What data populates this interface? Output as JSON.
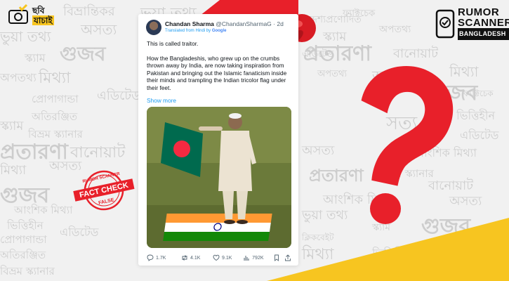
{
  "colors": {
    "brand_red": "#e8202a",
    "brand_yellow": "#f7c520",
    "link_blue": "#1d9bf0",
    "watermark_gray": "#cdcdcd"
  },
  "logo_left": {
    "line1": "ছবি",
    "line2": "যাচাই",
    "icon": "camera-check-icon"
  },
  "logo_right": {
    "line1": "RUMOR",
    "line2": "SCANNER",
    "line3": "BANGLADESH",
    "icon": "phone-check-icon"
  },
  "stamp": {
    "top": "RUMOR SCANNER",
    "middle": "FACT CHECK",
    "bottom": "FALSE"
  },
  "tweet": {
    "author_name": "Chandan Sharma",
    "handle_time": "@ChandanSharmaG · 2d",
    "translated": "Translated from Hindi by",
    "translator": "Google",
    "line1": "This is called traitor.",
    "paragraph": "How the Bangladeshis, who grew up on the crumbs thrown away by India, are now taking inspiration from Pakistan and bringing out the Islamic fanaticism inside their minds and trampling the Indian tricolor flag under their feet.",
    "show_more": "Show more",
    "replies": "1.7K",
    "reposts": "4.1K",
    "likes": "9.1K",
    "views": "792K"
  },
  "watermarks": {
    "w1": "ভুয়া তথ্য",
    "w2": "বিভ্রান্তিকর",
    "w3": "আংশিক মিথ্যা",
    "w4": "অসত্য",
    "w5": "গুজব",
    "w6": "বানোয়াট",
    "w7": "প্রতারণা",
    "w8": "অপতথ্য",
    "w9": "স্ক্যাম",
    "w10": "মিথ্যা",
    "w11": "এডিটেড",
    "w12": "প্রোপাগান্ডা",
    "w13": "অতিরঞ্জিত",
    "w14": "ভিত্তিহীন",
    "w15": "উদ্দেশ্যপ্রণোদিত",
    "w16": "ফ্যাক্টচেক",
    "w17": "সত্য",
    "w18": "বিভ্রম স্ক্যানার",
    "w19": "ক্লিকবেইট"
  }
}
